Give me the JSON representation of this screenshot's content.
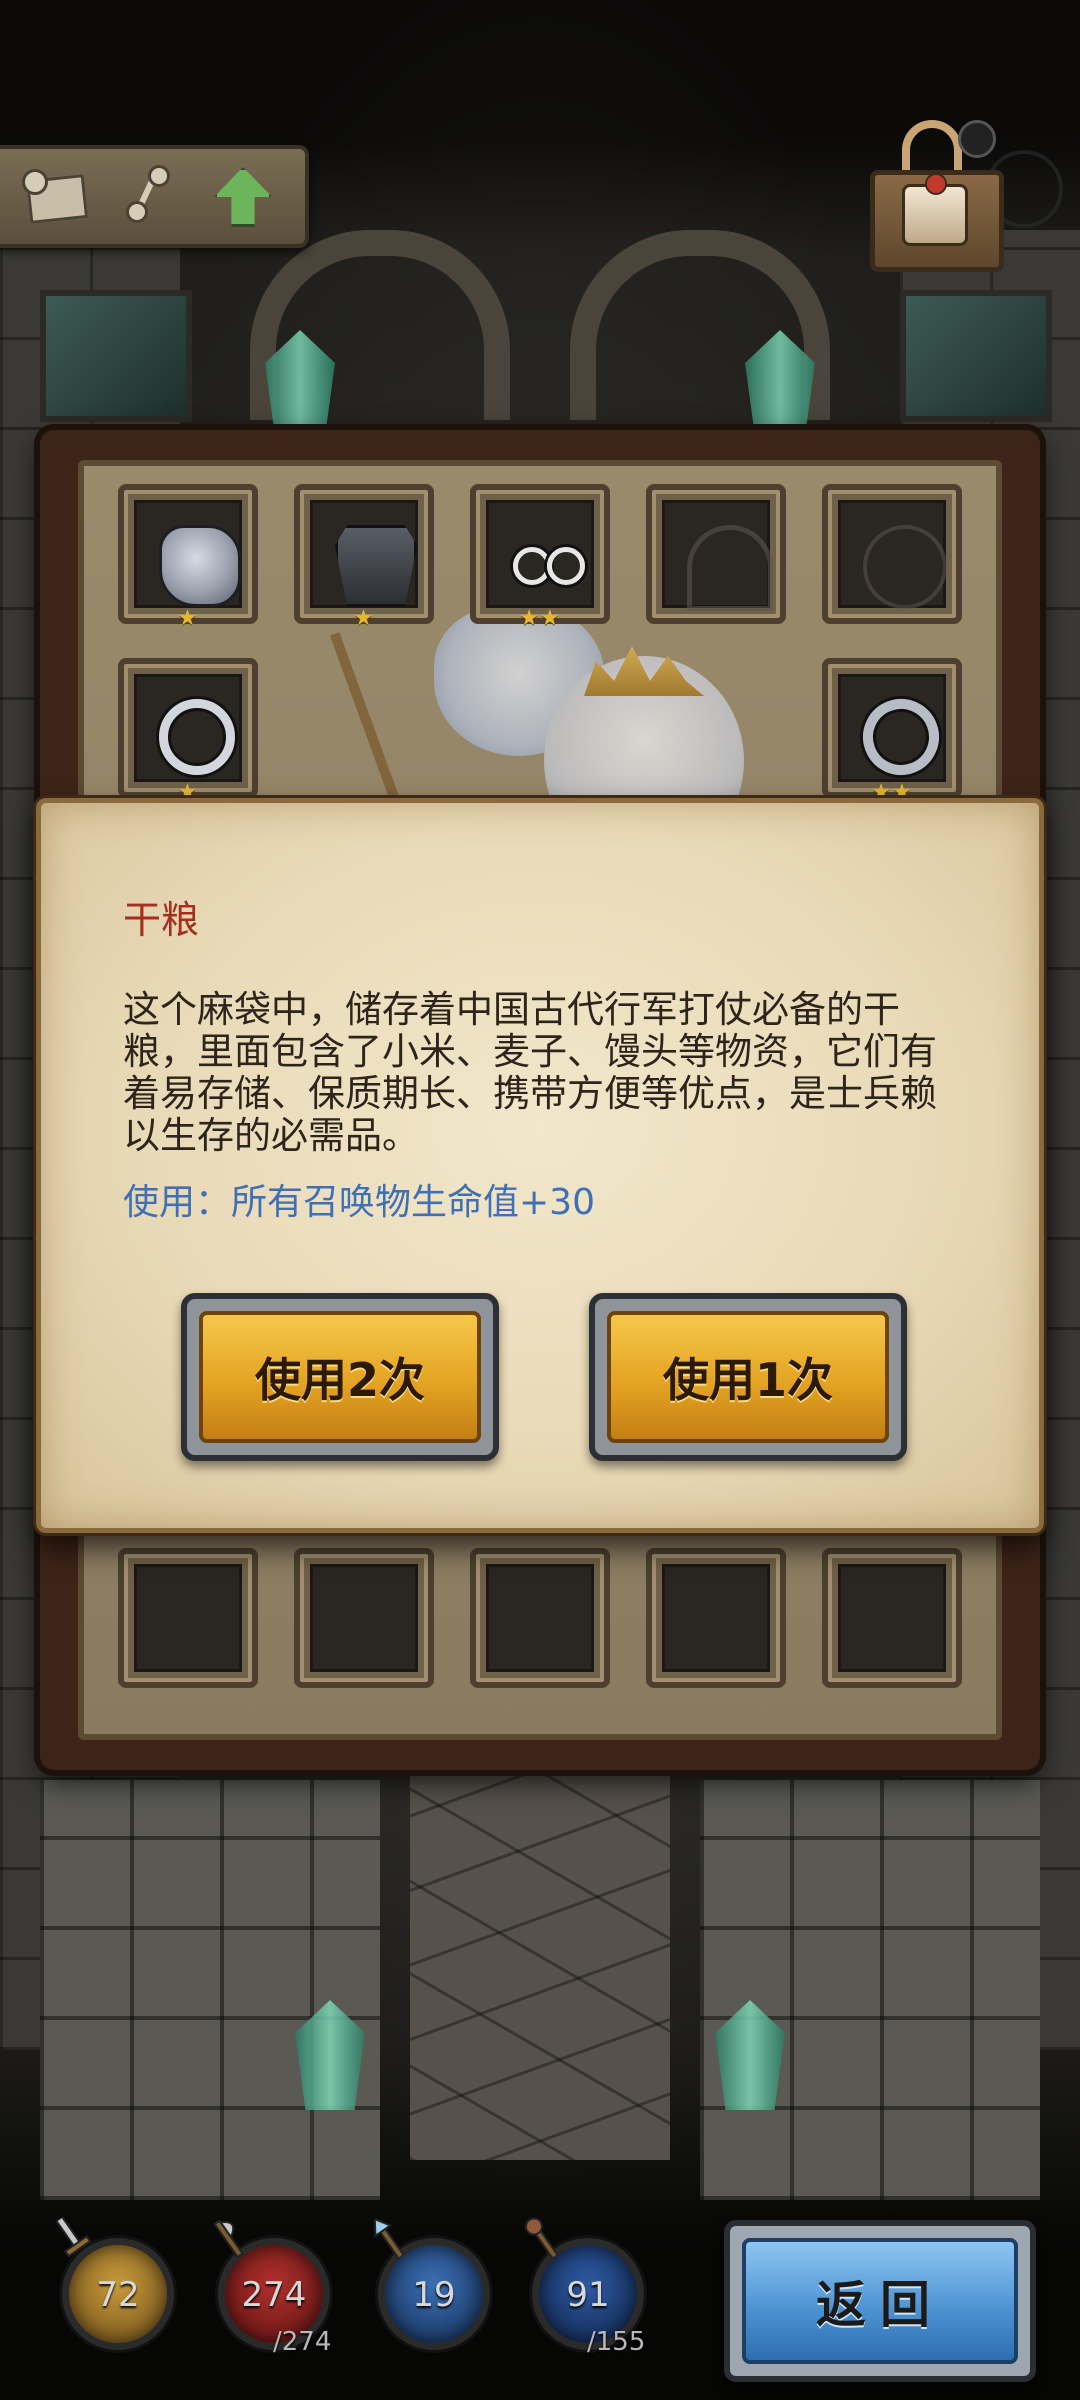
{
  "top_tools": {
    "icons": [
      "map-icon",
      "path-icon",
      "up-arrow-icon"
    ]
  },
  "shop": {
    "icon": "shop-sign-icon"
  },
  "inventory": {
    "rows": [
      [
        {
          "item": "gauntlet-icon",
          "stars": "★"
        },
        {
          "item": "armor-icon",
          "stars": "★"
        },
        {
          "item": "glasses-icon",
          "stars": "★★"
        },
        {
          "item": "crossbow-icon",
          "stars": ""
        },
        {
          "item": "amulet-icon",
          "stars": ""
        }
      ],
      [
        {
          "item": "ring-icon",
          "stars": "★"
        },
        {
          "item": "ring-icon",
          "stars": "★★"
        }
      ],
      [
        {
          "stars": ""
        },
        {
          "stars": ""
        },
        {
          "stars": ""
        },
        {
          "stars": "★★"
        },
        {
          "stars": "★★"
        }
      ]
    ]
  },
  "dialog": {
    "name": "干粮",
    "description": "这个麻袋中，储存着中国古代行军打仗必备的干粮，里面包含了小米、麦子、馒头等物资，它们有着易存储、保质期长、携带方便等优点，是士兵赖以生存的必需品。",
    "usage": "使用：所有召唤物生命值+30",
    "use_twice_label": "使用2次",
    "use_once_label": "使用1次"
  },
  "stats": {
    "attack": {
      "value": "72",
      "icon": "sword-icon",
      "color": "#c79a3b"
    },
    "hp": {
      "value": "274",
      "max": "/274",
      "icon": "axe-icon",
      "color": "#b0302c"
    },
    "defense": {
      "value": "19",
      "icon": "spear-icon",
      "color": "#3b6fb3"
    },
    "mp": {
      "value": "91",
      "max": "/155",
      "icon": "staff-icon",
      "color": "#2d5aa3"
    }
  },
  "back_label": "返回"
}
